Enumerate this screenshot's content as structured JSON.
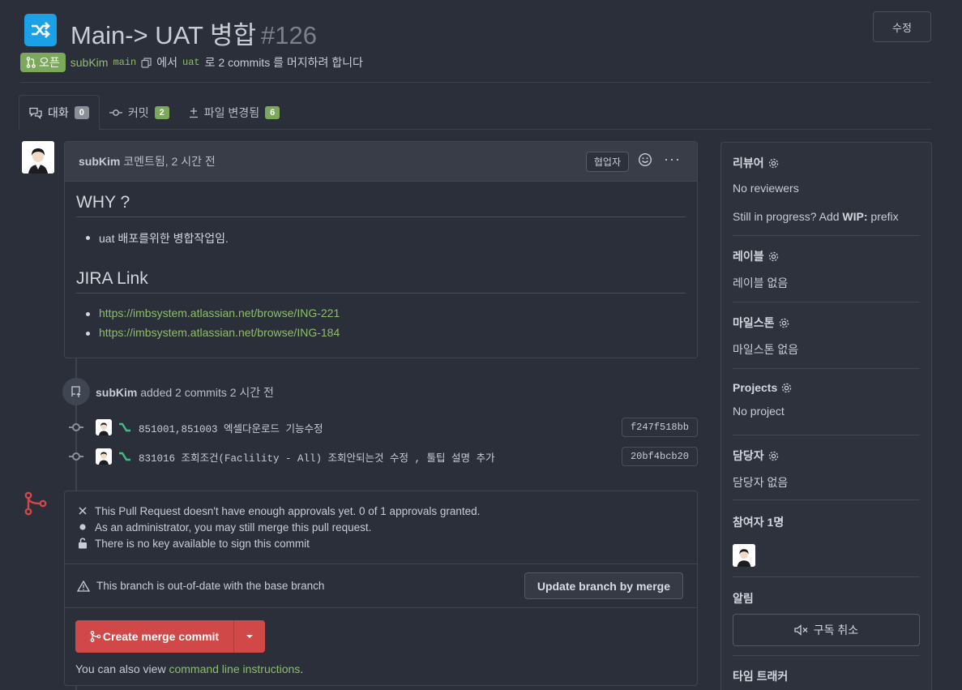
{
  "header": {
    "title": "Main-> UAT 병합",
    "number": "#126",
    "edit_label": "수정",
    "status": "오픈",
    "author": "subKim",
    "head_branch": "main",
    "from_text": "에서",
    "base_branch": "uat",
    "commits_text": "로 2 commits 를 머지하려 합니다"
  },
  "tabs": [
    {
      "label": "대화",
      "count": "0"
    },
    {
      "label": "커밋",
      "count": "2"
    },
    {
      "label": "파일 변경됨",
      "count": "6"
    }
  ],
  "comment": {
    "author": "subKim",
    "meta": "코멘트됨, 2 시간 전",
    "role": "협업자",
    "heading1": "WHY ?",
    "items1": [
      "uat 배포를위한 병합작업임."
    ],
    "heading2": "JIRA Link",
    "links": [
      "https://imbsystem.atlassian.net/browse/ING-221",
      "https://imbsystem.atlassian.net/browse/ING-184"
    ]
  },
  "event": {
    "author": "subKim",
    "text": "added 2 commits 2 시간 전"
  },
  "commits": [
    {
      "message": "851001,851003 엑셀다운로드 기능수정",
      "sha": "f247f518bb"
    },
    {
      "message": "831016 조회조건(Faclility - All) 조회안되는것 수정 , 툴팁 설명 추가",
      "sha": "20bf4bcb20"
    }
  ],
  "merge": {
    "line1": "This Pull Request doesn't have enough approvals yet. 0 of 1 approvals granted.",
    "line2": "As an administrator, you may still merge this pull request.",
    "line3": "There is no key available to sign this commit",
    "outdated": "This branch is out-of-date with the base branch",
    "update_button": "Update branch by merge",
    "merge_button": "Create merge commit",
    "cli_prefix": "You can also view",
    "cli_link": "command line instructions",
    "cli_suffix": "."
  },
  "sidebar": {
    "reviewers_title": "리뷰어",
    "reviewers_value": "No reviewers",
    "wip_text": "Still in progress? Add",
    "wip_bold": "WIP:",
    "wip_suffix": "prefix",
    "labels_title": "레이블",
    "labels_value": "레이블 없음",
    "milestone_title": "마일스톤",
    "milestone_value": "마일스톤 없음",
    "projects_title": "Projects",
    "projects_value": "No project",
    "assignee_title": "담당자",
    "assignee_value": "담당자 없음",
    "participants_title": "참여자 1명",
    "notifications_title": "알림",
    "unsubscribe_label": "구독 취소",
    "time_tracker_title": "타임 트래커"
  },
  "colors": {
    "background": "#2b2f3a",
    "accent_green": "#8fbe6a",
    "merge_red": "#d04848",
    "repo_icon": "#1aa1e6"
  }
}
